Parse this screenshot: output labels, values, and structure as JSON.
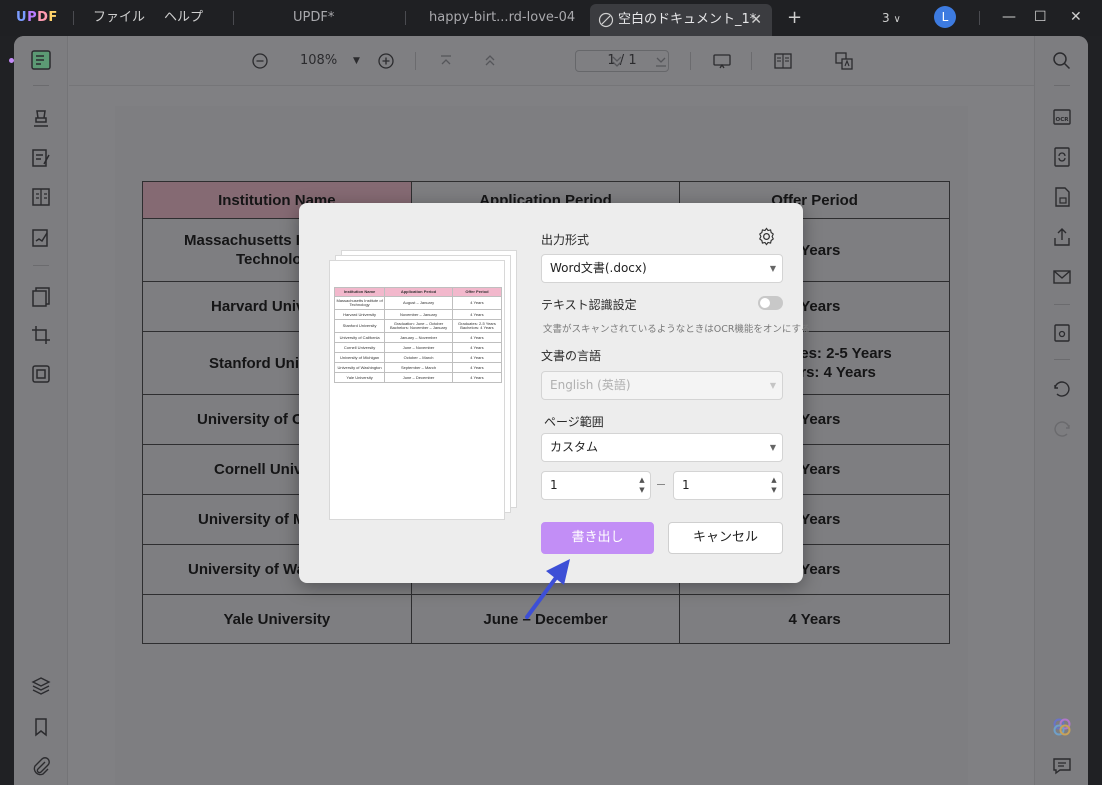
{
  "titlebar": {
    "logo": "UPDF",
    "menu_file": "ファイル",
    "menu_help": "ヘルプ",
    "tabs": [
      {
        "label": "UPDF*"
      },
      {
        "label": "happy-birt...rd-love-04"
      },
      {
        "label": "空白のドキュメント_1*"
      }
    ],
    "tab_count": "3",
    "avatar_initial": "L"
  },
  "toolbar": {
    "zoom": "108%",
    "page_indicator": "1 / 1"
  },
  "document": {
    "headers": [
      "Institution Name",
      "Application Period",
      "Offer Period"
    ],
    "rows": [
      [
        "Massachusetts Institute of Technology",
        "",
        "4 Years"
      ],
      [
        "Harvard University",
        "",
        "4 Years"
      ],
      [
        "Stanford University",
        "",
        "Graduates: 2-5 Years\nBachelors: 4 Years"
      ],
      [
        "University of California",
        "",
        "4 Years"
      ],
      [
        "Cornell University",
        "",
        "4 Years"
      ],
      [
        "University of Michigan",
        "",
        "4 Years"
      ],
      [
        "University of Washington",
        "",
        "4 Years"
      ],
      [
        "Yale University",
        "June – December",
        "4 Years"
      ]
    ],
    "visible_left": [
      "Massachusetts In",
      "Technolo",
      "Harvard Univ",
      "Stanford Univ",
      "University of C",
      "Cornell Univ",
      "University of M",
      "University of Wa",
      "Yale University"
    ],
    "visible_right": [
      "Years",
      "Years",
      "es: 2-5 Years",
      "rs: 4 Years",
      "Years",
      "Years",
      "Years",
      "Years",
      "4 Years"
    ]
  },
  "dialog": {
    "output_format_label": "出力形式",
    "output_format_value": "Word文書(.docx)",
    "ocr_label": "テキスト認識設定",
    "ocr_hint": "文書がスキャンされているようなときはOCR機能をオンにする",
    "ocr_enabled": false,
    "language_label": "文書の言語",
    "language_value": "English (英語)",
    "page_range_label": "ページ範囲",
    "page_range_value": "カスタム",
    "page_from": "1",
    "page_to": "1",
    "export_button": "書き出し",
    "cancel_button": "キャンセル"
  },
  "preview": {
    "headers": [
      "Institution Name",
      "Application Period",
      "Offer Period"
    ],
    "rows": [
      [
        "Massachusetts Institute of Technology",
        "August – January",
        "4 Years"
      ],
      [
        "Harvard University",
        "November – January",
        "4 Years"
      ],
      [
        "Stanford University",
        "Graduation: June – October Bachelors: November – January",
        "Graduates: 2-5 Years Bachelors: 4 Years"
      ],
      [
        "University of California",
        "January – November",
        "4 Years"
      ],
      [
        "Cornell University",
        "June – November",
        "4 Years"
      ],
      [
        "University of Michigan",
        "October – March",
        "4 Years"
      ],
      [
        "University of Washington",
        "September – March",
        "4 Years"
      ],
      [
        "Yale University",
        "June – December",
        "4 Years"
      ]
    ]
  },
  "colors": {
    "accent_button": "#c28ef6",
    "annotation_arrow": "#3d4fd6",
    "table_header_pink": "#f2b8cc"
  }
}
